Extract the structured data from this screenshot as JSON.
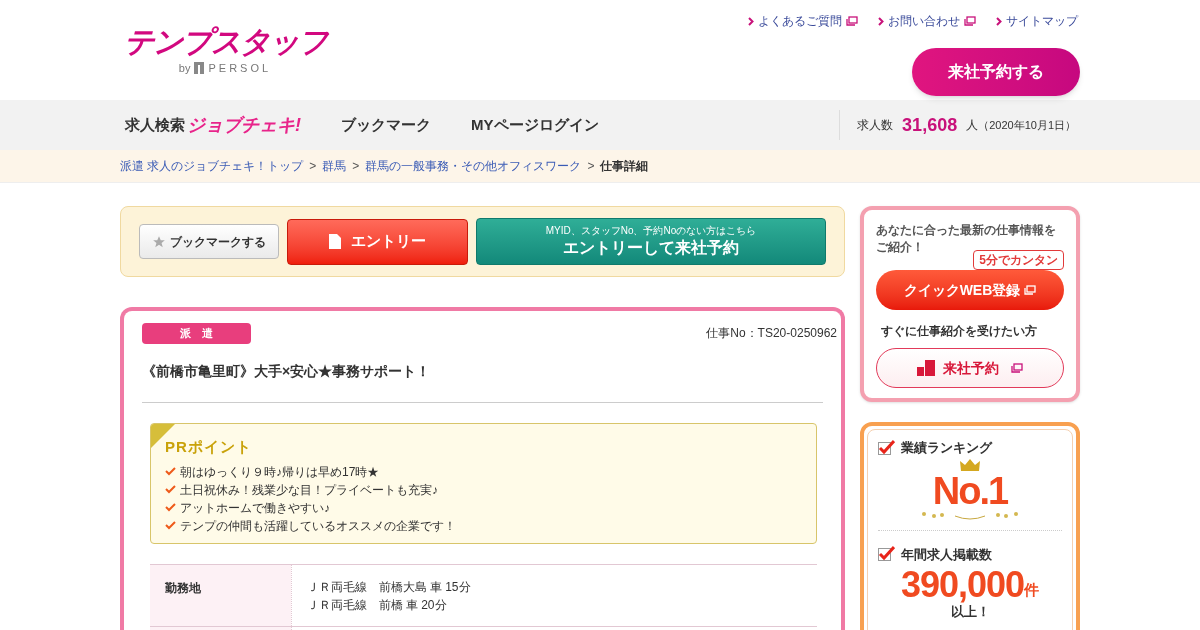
{
  "logo": {
    "name": "テンプスタッフ",
    "by": "by",
    "brand": "PERSOL"
  },
  "top_links": [
    {
      "label": "よくあるご質問",
      "external": true
    },
    {
      "label": "お問い合わせ",
      "external": true
    },
    {
      "label": "サイトマップ",
      "external": false
    }
  ],
  "header_button": "来社予約する",
  "nav": {
    "search_label": "求人検索",
    "search_brand": "ジョブチェキ!",
    "items": [
      "ブックマーク",
      "MYページログイン"
    ]
  },
  "job_count": {
    "label": "求人数",
    "value": "31,608",
    "unit": "人",
    "date": "（2020年10月1日）"
  },
  "breadcrumb": [
    {
      "label": "派遣 求人のジョブチェキ！トップ",
      "current": false
    },
    {
      "label": "群馬",
      "current": false
    },
    {
      "label": "群馬の一般事務・その他オフィスワーク",
      "current": false
    },
    {
      "label": "仕事詳細",
      "current": true
    }
  ],
  "breadcrumb_separator": ">",
  "actions": {
    "bookmark": "ブックマークする",
    "entry": "エントリー",
    "reserve_note": "MYID、スタッフNo、予約Noのない方はこちら",
    "reserve": "エントリーして来社予約"
  },
  "job": {
    "type_badge": "派　遣",
    "job_no": "仕事No：TS20-0250962",
    "title": "《前橋市亀里町》大手×安心★事務サポート！",
    "pr": {
      "heading": "PRポイント",
      "points": [
        "朝はゆっくり９時♪帰りは早め17時★",
        "土日祝休み！残業少な目！プライベートも充実♪",
        "アットホームで働きやすい♪",
        "テンプの仲間も活躍しているオススメの企業です！"
      ]
    },
    "details": [
      {
        "label": "勤務地",
        "lines": [
          "ＪＲ両毛線　前橋大島 車 15分",
          "ＪＲ両毛線　前橋 車 20分"
        ]
      }
    ]
  },
  "promo": {
    "intro": "あなたに合った最新の仕事情報をご紹介！",
    "badge": "5分でカンタン",
    "web_button": "クイックWEB登録",
    "sub_text": "すぐに仕事紹介を受けたい方",
    "reserve_button": "来社予約"
  },
  "ranking": {
    "items": [
      {
        "heading": "業績ランキング",
        "checked": true,
        "kind": "rank",
        "value": "No.1"
      },
      {
        "heading": "年間求人掲載数",
        "checked": true,
        "kind": "count",
        "value": "390,000",
        "unit": "件",
        "note": "以上！"
      }
    ]
  }
}
